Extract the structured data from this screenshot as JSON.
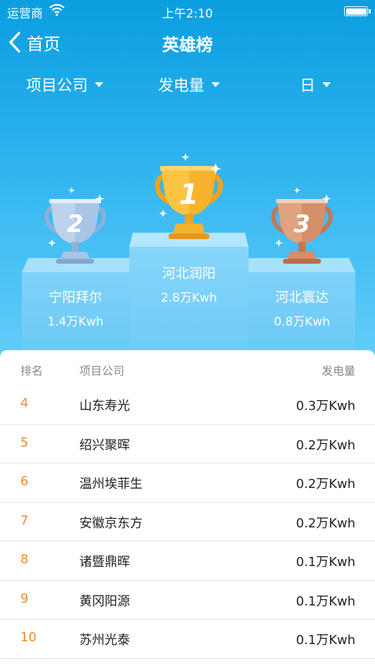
{
  "status_bar": {
    "carrier": "运营商",
    "time": "上午2:10"
  },
  "nav": {
    "back_label": "首页",
    "title": "英雄榜"
  },
  "filters": [
    {
      "label": "项目公司"
    },
    {
      "label": "发电量"
    },
    {
      "label": "日"
    }
  ],
  "podium": {
    "first": {
      "rank": "1",
      "name": "河北润阳",
      "value": "2.8万Kwh"
    },
    "second": {
      "rank": "2",
      "name": "宁阳拜尔",
      "value": "1.4万Kwh"
    },
    "third": {
      "rank": "3",
      "name": "河北寰达",
      "value": "0.8万Kwh"
    }
  },
  "list": {
    "headers": {
      "rank": "排名",
      "company": "项目公司",
      "generation": "发电量"
    },
    "rows": [
      {
        "rank": "4",
        "name": "山东寿光",
        "value": "0.3万Kwh"
      },
      {
        "rank": "5",
        "name": "绍兴聚晖",
        "value": "0.2万Kwh"
      },
      {
        "rank": "6",
        "name": "温州埃菲生",
        "value": "0.2万Kwh"
      },
      {
        "rank": "7",
        "name": "安徽京东方",
        "value": "0.2万Kwh"
      },
      {
        "rank": "8",
        "name": "诸暨鼎晖",
        "value": "0.1万Kwh"
      },
      {
        "rank": "9",
        "name": "黄冈阳源",
        "value": "0.1万Kwh"
      },
      {
        "rank": "10",
        "name": "苏州光泰",
        "value": "0.1万Kwh"
      }
    ]
  },
  "colors": {
    "rank_accent": "#f08a2c",
    "gold": "#f7b32b",
    "silver": "#a9c5e6",
    "bronze": "#d48e68"
  }
}
